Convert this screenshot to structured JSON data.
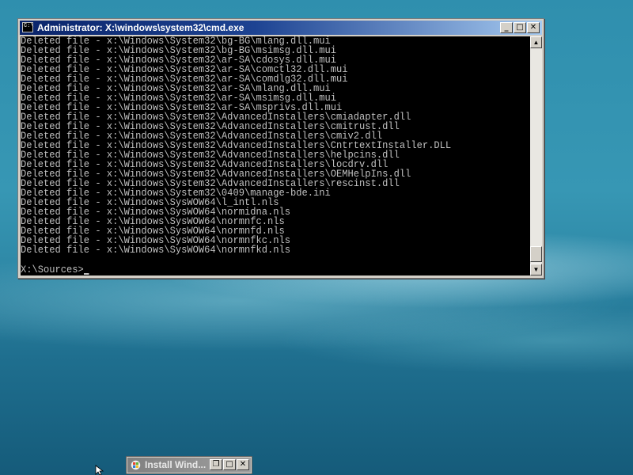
{
  "cmd_window": {
    "title": "Administrator: X:\\windows\\system32\\cmd.exe",
    "icon_label": "C:\\",
    "controls": {
      "minimize": "_",
      "maximize": "□",
      "close": "✕"
    },
    "lines": [
      "Deleted file - x:\\Windows\\System32\\bg-BG\\mlang.dll.mui",
      "Deleted file - x:\\Windows\\System32\\bg-BG\\msimsg.dll.mui",
      "Deleted file - x:\\Windows\\System32\\ar-SA\\cdosys.dll.mui",
      "Deleted file - x:\\Windows\\System32\\ar-SA\\comctl32.dll.mui",
      "Deleted file - x:\\Windows\\System32\\ar-SA\\comdlg32.dll.mui",
      "Deleted file - x:\\Windows\\System32\\ar-SA\\mlang.dll.mui",
      "Deleted file - x:\\Windows\\System32\\ar-SA\\msimsg.dll.mui",
      "Deleted file - x:\\Windows\\System32\\ar-SA\\msprivs.dll.mui",
      "Deleted file - x:\\Windows\\System32\\AdvancedInstallers\\cmiadapter.dll",
      "Deleted file - x:\\Windows\\System32\\AdvancedInstallers\\cmitrust.dll",
      "Deleted file - x:\\Windows\\System32\\AdvancedInstallers\\cmiv2.dll",
      "Deleted file - x:\\Windows\\System32\\AdvancedInstallers\\CntrtextInstaller.DLL",
      "Deleted file - x:\\Windows\\System32\\AdvancedInstallers\\helpcins.dll",
      "Deleted file - x:\\Windows\\System32\\AdvancedInstallers\\locdrv.dll",
      "Deleted file - x:\\Windows\\System32\\AdvancedInstallers\\OEMHelpIns.dll",
      "Deleted file - x:\\Windows\\System32\\AdvancedInstallers\\rescinst.dll",
      "Deleted file - x:\\Windows\\System32\\0409\\manage-bde.ini",
      "Deleted file - x:\\Windows\\SysWOW64\\l_intl.nls",
      "Deleted file - x:\\Windows\\SysWOW64\\normidna.nls",
      "Deleted file - x:\\Windows\\SysWOW64\\normnfc.nls",
      "Deleted file - x:\\Windows\\SysWOW64\\normnfd.nls",
      "Deleted file - x:\\Windows\\SysWOW64\\normnfkc.nls",
      "Deleted file - x:\\Windows\\SysWOW64\\normnfkd.nls"
    ],
    "prompt": "X:\\Sources>",
    "scrollbar": {
      "up_arrow": "▲",
      "down_arrow": "▼"
    }
  },
  "minimized_window": {
    "title": "Install Wind...",
    "controls": {
      "restore": "❐",
      "maximize": "□",
      "close": "✕"
    }
  },
  "colors": {
    "console_bg": "#000000",
    "console_text": "#c0c0c0",
    "title_active_start": "#0a246a",
    "title_active_end": "#a6caf0",
    "desktop": "#2f8fae"
  },
  "icons": {
    "cmd": "console-icon",
    "installer": "windows-flag-icon",
    "pointer": "mouse-pointer-icon"
  }
}
